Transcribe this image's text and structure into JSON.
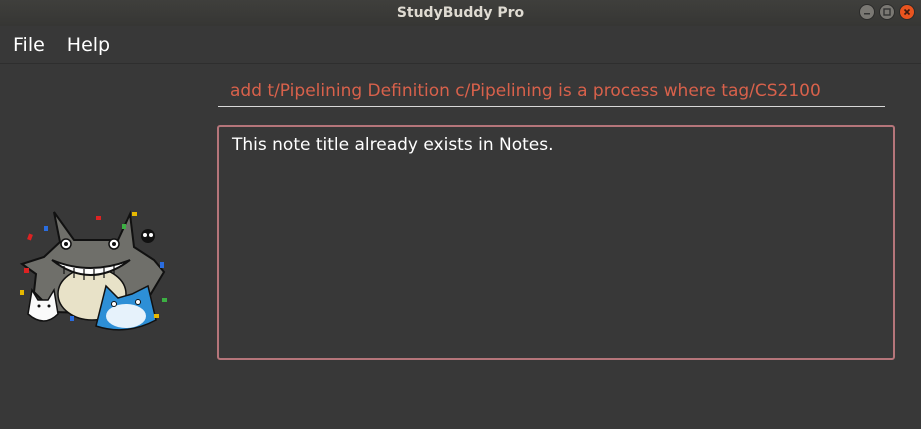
{
  "window": {
    "title": "StudyBuddy Pro",
    "controls": [
      {
        "name": "minimize-icon"
      },
      {
        "name": "maximize-icon"
      },
      {
        "name": "close-icon"
      }
    ]
  },
  "menu": {
    "items": [
      {
        "label": "File"
      },
      {
        "label": "Help"
      }
    ]
  },
  "command": {
    "value": "add t/Pipelining Definition c/Pipelining is a process where tag/CS2100",
    "color": "#d8614b"
  },
  "result": {
    "message": "This note title already exists in Notes.",
    "border_color": "#b5757a"
  },
  "mascot": {
    "icon": "totoro-mascot-icon"
  },
  "colors": {
    "background": "#383838",
    "text": "#ffffff",
    "close_button": "#e9541f"
  }
}
